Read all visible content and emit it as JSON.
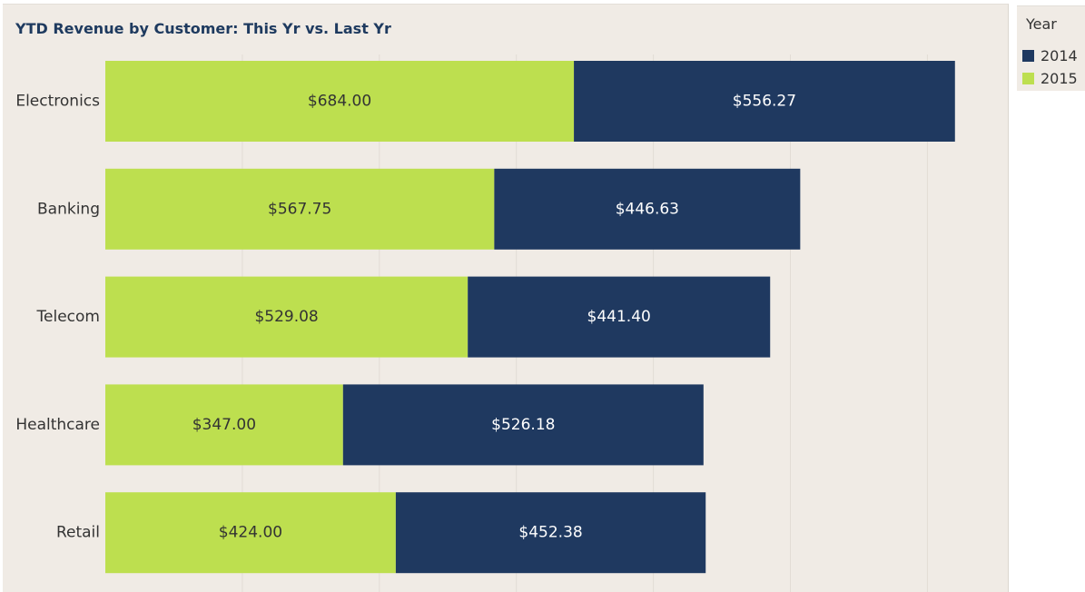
{
  "chart_data": {
    "type": "bar",
    "orientation": "horizontal",
    "stacked": true,
    "title": "YTD Revenue by Customer: This Yr vs. Last Yr",
    "xlabel": "",
    "ylabel": "",
    "categories": [
      "Electronics",
      "Banking",
      "Telecom",
      "Healthcare",
      "Retail"
    ],
    "series": [
      {
        "name": "2015",
        "color": "#bddf4f",
        "values": [
          684.0,
          567.75,
          529.08,
          347.0,
          424.0
        ],
        "labels": [
          "$684.00",
          "$567.75",
          "$529.08",
          "$347.00",
          "$424.00"
        ],
        "label_color": "#333333"
      },
      {
        "name": "2014",
        "color": "#1f3960",
        "values": [
          556.27,
          446.63,
          441.4,
          526.18,
          452.38
        ],
        "labels": [
          "$556.27",
          "$446.63",
          "$441.40",
          "$526.18",
          "$452.38"
        ],
        "label_color": "#ffffff"
      }
    ],
    "xlim": [
      0,
      1300
    ],
    "grid": true,
    "legend": {
      "title": "Year",
      "placement": "top-right",
      "entries": [
        {
          "name": "2014",
          "color": "#1f3960"
        },
        {
          "name": "2015",
          "color": "#bddf4f"
        }
      ]
    }
  }
}
